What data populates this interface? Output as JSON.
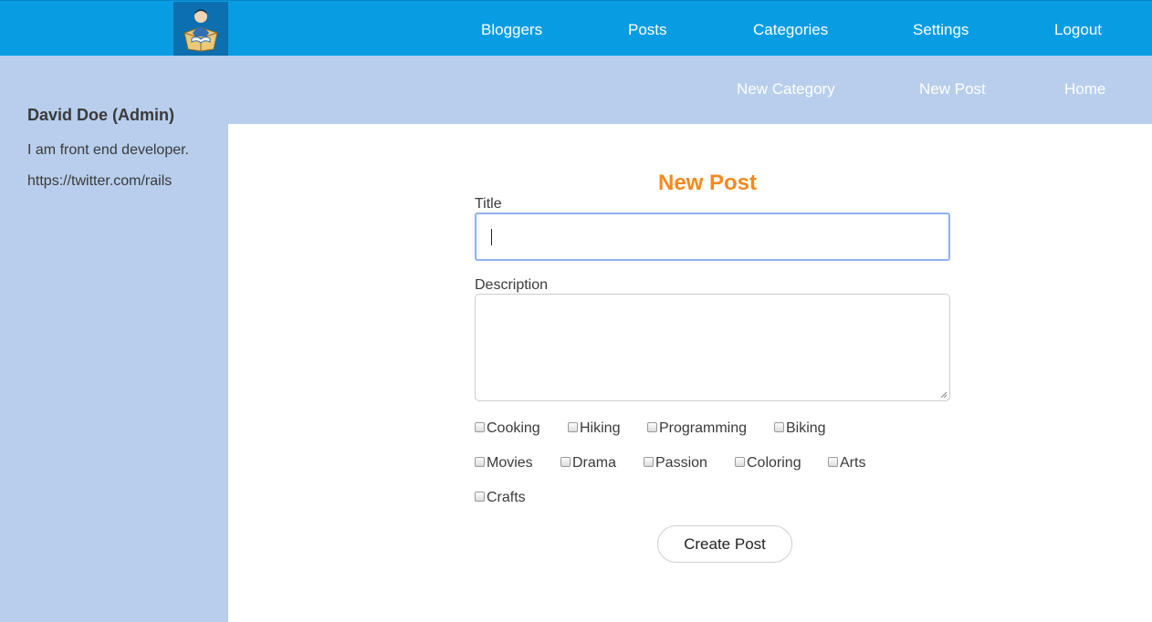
{
  "header": {
    "logo_icon": "book-reader-logo-icon",
    "nav": [
      "Bloggers",
      "Posts",
      "Categories",
      "Settings",
      "Logout"
    ]
  },
  "subnav": [
    "New Category",
    "New Post",
    "Home"
  ],
  "sidebar": {
    "name": "David Doe (Admin)",
    "bio": "I am front end developer.",
    "link": "https://twitter.com/rails"
  },
  "form": {
    "heading": "New Post",
    "title_label": "Title",
    "title_value": "",
    "description_label": "Description",
    "description_value": "",
    "categories": [
      "Cooking",
      "Hiking",
      "Programming",
      "Biking",
      "Movies",
      "Drama",
      "Passion",
      "Coloring",
      "Arts",
      "Crafts"
    ],
    "submit_label": "Create Post"
  },
  "colors": {
    "header_bg": "#089de3",
    "sidebar_bg": "#b8ceec",
    "heading": "#f5891d"
  }
}
